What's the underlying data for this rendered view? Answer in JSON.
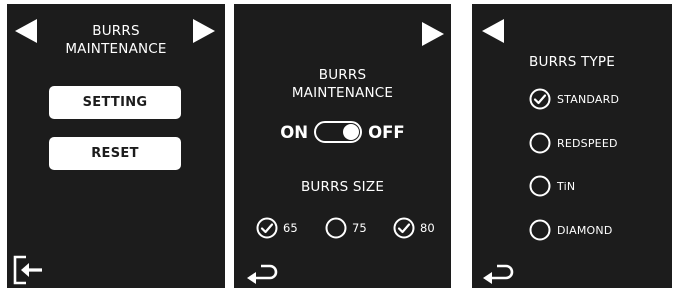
{
  "colors": {
    "panel_background": "#1c1c1c",
    "foreground": "#ffffff",
    "page_background": "#ffffff"
  },
  "screen_1": {
    "title_line1": "BURRS",
    "title_line2": "MAINTENANCE",
    "setting_label": "SETTING",
    "reset_label": "RESET",
    "icons": [
      "arrow-left-icon",
      "arrow-right-icon",
      "exit-icon"
    ]
  },
  "screen_2": {
    "title_line1": "BURRS",
    "title_line2": "MAINTENANCE",
    "toggle_on_label": "ON",
    "toggle_off_label": "OFF",
    "toggle_state": "OFF",
    "size_label": "BURRS SIZE",
    "size_options": [
      {
        "label": "65",
        "checked": true
      },
      {
        "label": "75",
        "checked": false
      },
      {
        "label": "80",
        "checked": true
      }
    ],
    "icons": [
      "arrow-right-icon",
      "back-icon"
    ]
  },
  "screen_3": {
    "title": "BURRS TYPE",
    "type_options": [
      {
        "label": "STANDARD",
        "checked": true
      },
      {
        "label": "REDSPEED",
        "checked": false
      },
      {
        "label": "TiN",
        "checked": false
      },
      {
        "label": "DIAMOND",
        "checked": false
      }
    ],
    "icons": [
      "arrow-left-icon",
      "back-icon"
    ]
  }
}
